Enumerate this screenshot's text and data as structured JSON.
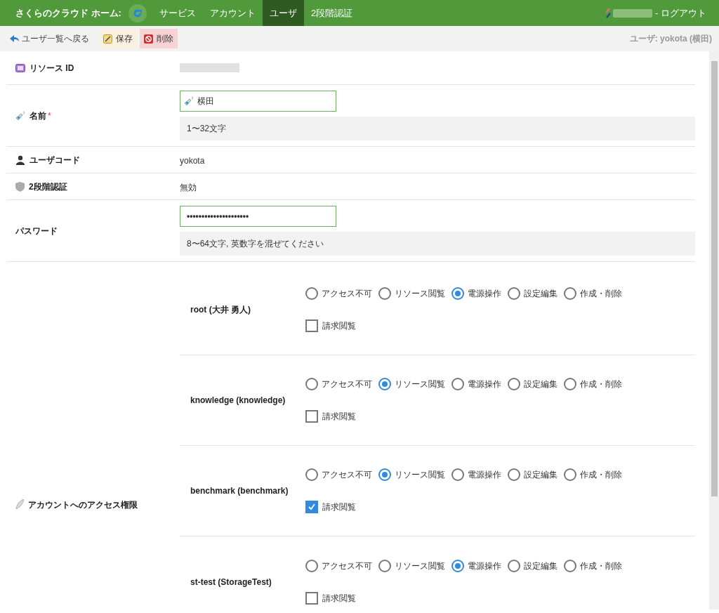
{
  "nav": {
    "brand": "さくらのクラウド ホーム:",
    "items": [
      {
        "label": "サービス",
        "selected": false
      },
      {
        "label": "アカウント",
        "selected": false
      },
      {
        "label": "ユーザ",
        "selected": true
      },
      {
        "label": "2段階認証",
        "selected": false
      }
    ],
    "logout": "- ログアウト"
  },
  "toolbar": {
    "back": "ユーザ一覧へ戻る",
    "save": "保存",
    "delete": "削除",
    "user_label": "ユーザ: yokota (横田)"
  },
  "fields": [
    {
      "kind": "text",
      "label": "リソース ID"
    },
    {
      "kind": "input",
      "label": "名前",
      "required_mark": "*",
      "value": "横田",
      "hint": "1〜32文字"
    },
    {
      "kind": "text",
      "label": "ユーザコード",
      "value": "yokota"
    },
    {
      "kind": "text",
      "label": "2段階認証",
      "value": "無効"
    },
    {
      "kind": "password",
      "label": "パスワード",
      "value": "•••••••••••••••••••••",
      "hint": "8〜64文字, 英数字を混ぜてください"
    }
  ],
  "permissions": {
    "label": "アカウントへのアクセス権限",
    "accounts": [
      {
        "name": "root (大井 勇人)",
        "options": [
          {
            "label": "アクセス不可",
            "selected": false
          },
          {
            "label": "リソース閲覧",
            "selected": false
          },
          {
            "label": "電源操作",
            "selected": true
          },
          {
            "label": "設定編集",
            "selected": false
          },
          {
            "label": "作成・削除",
            "selected": false
          }
        ],
        "billing": {
          "label": "請求閲覧",
          "checked": false
        }
      },
      {
        "name": "knowledge (knowledge)",
        "options": [
          {
            "label": "アクセス不可",
            "selected": false
          },
          {
            "label": "リソース閲覧",
            "selected": true
          },
          {
            "label": "電源操作",
            "selected": false
          },
          {
            "label": "設定編集",
            "selected": false
          },
          {
            "label": "作成・削除",
            "selected": false
          }
        ],
        "billing": {
          "label": "請求閲覧",
          "checked": false
        }
      },
      {
        "name": "benchmark (benchmark)",
        "options": [
          {
            "label": "アクセス不可",
            "selected": false
          },
          {
            "label": "リソース閲覧",
            "selected": true
          },
          {
            "label": "電源操作",
            "selected": false
          },
          {
            "label": "設定編集",
            "selected": false
          },
          {
            "label": "作成・削除",
            "selected": false
          }
        ],
        "billing": {
          "label": "請求閲覧",
          "checked": true
        }
      },
      {
        "name": "st-test (StorageTest)",
        "options": [
          {
            "label": "アクセス不可",
            "selected": false
          },
          {
            "label": "リソース閲覧",
            "selected": false
          },
          {
            "label": "電源操作",
            "selected": true
          },
          {
            "label": "設定編集",
            "selected": false
          },
          {
            "label": "作成・削除",
            "selected": false
          }
        ],
        "billing": {
          "label": "請求閲覧",
          "checked": false
        }
      }
    ]
  }
}
